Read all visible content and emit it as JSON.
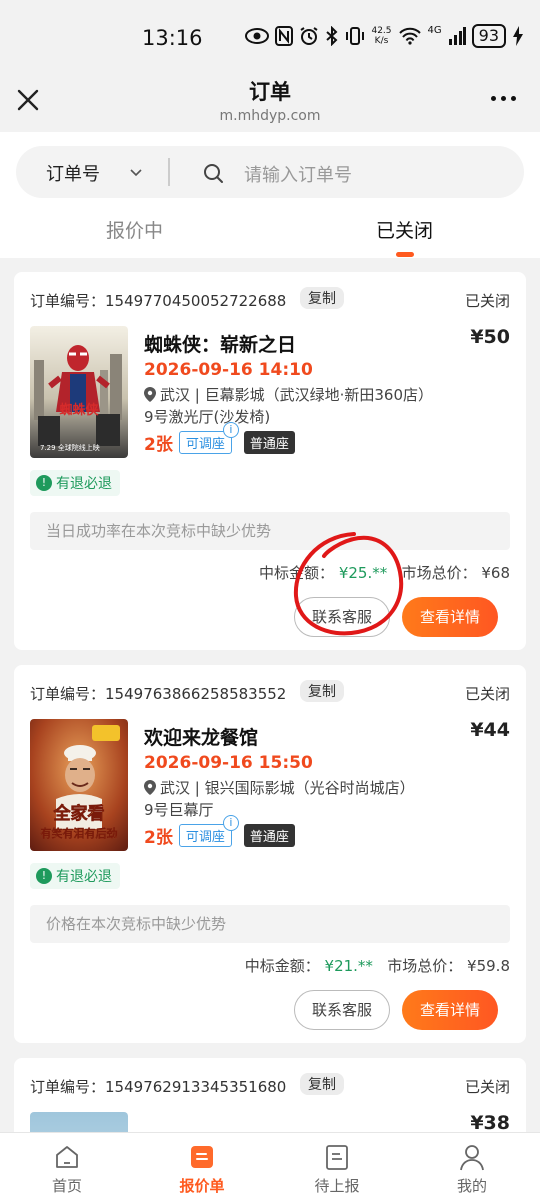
{
  "status_bar": {
    "time": "13:16",
    "net_speed_value": "42.5",
    "net_speed_unit": "K/s",
    "network": "4G",
    "battery": "93"
  },
  "header": {
    "title": "订单",
    "subtitle": "m.mhdyp.com"
  },
  "search": {
    "selector_label": "订单号",
    "placeholder": "请输入订单号"
  },
  "tabs": [
    {
      "label": "报价中",
      "active": false
    },
    {
      "label": "已关闭",
      "active": true
    }
  ],
  "orders": [
    {
      "order_no_label": "订单编号：",
      "order_no": "1549770450052722688",
      "copy_label": "复制",
      "status": "已关闭",
      "movie": "蜘蛛侠：崭新之日",
      "price": "¥50",
      "datetime": "2026-09-16 14:10",
      "location": "武汉 | 巨幕影城（武汉绿地·新田360店）",
      "hall": "9号激光厅(沙发椅)",
      "count": "2张",
      "tag_adjust": "可调座",
      "tag_seat": "普通座",
      "refund": "有退必退",
      "notice": "当日成功率在本次竞标中缺少优势",
      "win_label": "中标金额：",
      "win_amount": "¥25.**",
      "market_label": "市场总价：",
      "market_amount": "¥68",
      "btn_service": "联系客服",
      "btn_detail": "查看详情"
    },
    {
      "order_no_label": "订单编号：",
      "order_no": "1549763866258583552",
      "copy_label": "复制",
      "status": "已关闭",
      "movie": "欢迎来龙餐馆",
      "price": "¥44",
      "datetime": "2026-09-16 15:50",
      "location": "武汉 | 银兴国际影城（光谷时尚城店）",
      "hall": "9号巨幕厅",
      "count": "2张",
      "tag_adjust": "可调座",
      "tag_seat": "普通座",
      "refund": "有退必退",
      "notice": "价格在本次竞标中缺少优势",
      "win_label": "中标金额：",
      "win_amount": "¥21.**",
      "market_label": "市场总价：",
      "market_amount": "¥59.8",
      "btn_service": "联系客服",
      "btn_detail": "查看详情"
    },
    {
      "order_no_label": "订单编号：",
      "order_no": "1549762913345351680",
      "copy_label": "复制",
      "status": "已关闭",
      "price": "¥38"
    }
  ],
  "posters": {
    "spiderman_text": "蜘蛛侠",
    "spiderman_date": "7.29 全球院线上映",
    "dragon_text_1": "全家看",
    "dragon_text_2": "有笑有泪有后劲"
  },
  "bottom_nav": [
    {
      "label": "首页",
      "icon": "home-icon",
      "active": false
    },
    {
      "label": "报价单",
      "icon": "quote-icon",
      "active": true
    },
    {
      "label": "待上报",
      "icon": "pending-icon",
      "active": false
    },
    {
      "label": "我的",
      "icon": "profile-icon",
      "active": false
    }
  ],
  "colors": {
    "accent": "#ff5a1f",
    "price_red": "#f04a1e",
    "green": "#1e9a5c",
    "blue_tag": "#2b8fe0"
  }
}
